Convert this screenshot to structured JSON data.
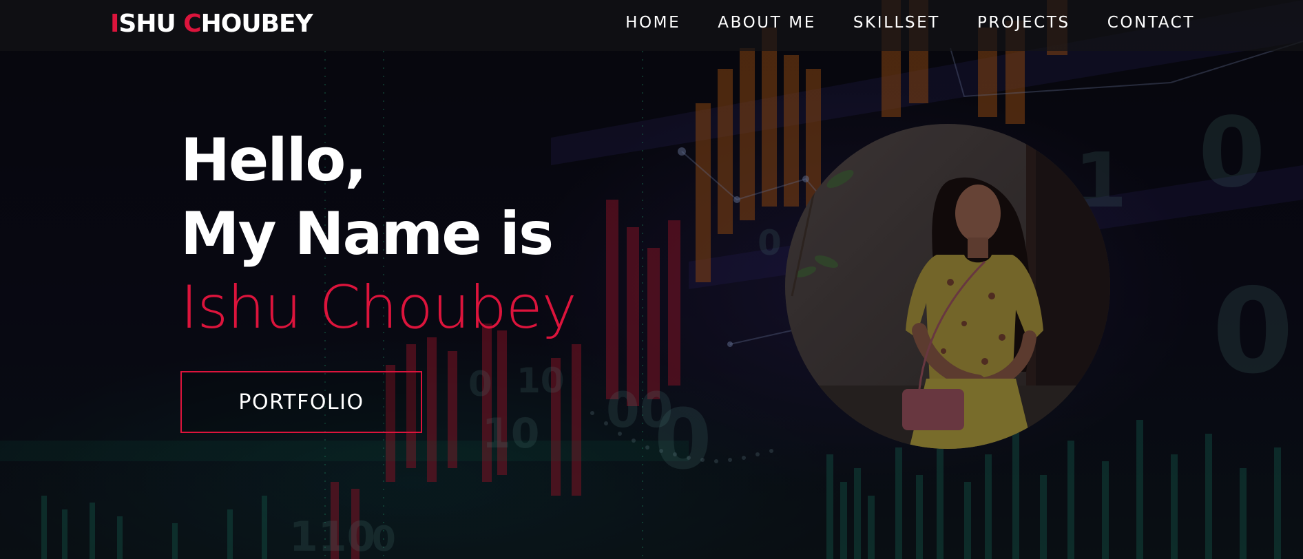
{
  "app": {
    "brand": {
      "first_initial": "I",
      "first_rest": "SHU ",
      "last_initial": "C",
      "last_rest": "HOUBEY"
    },
    "accent_color": "#dc143c"
  },
  "nav": {
    "items": [
      {
        "label": "HOME"
      },
      {
        "label": "ABOUT ME"
      },
      {
        "label": "SKILLSET"
      },
      {
        "label": "PROJECTS"
      },
      {
        "label": "CONTACT"
      }
    ]
  },
  "hero": {
    "greeting": "Hello,",
    "intro": "My Name is",
    "name": "Ishu Choubey",
    "cta_label": "PORTFOLIO"
  },
  "profile": {
    "icon": "profile-photo"
  }
}
